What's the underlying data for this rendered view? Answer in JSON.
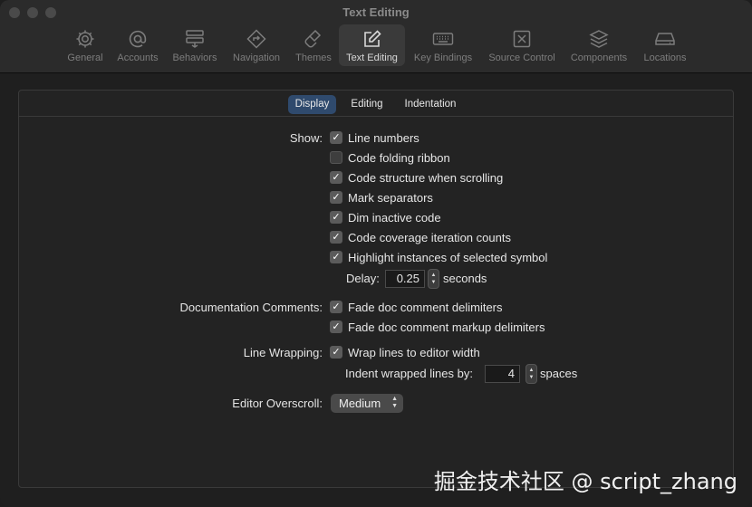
{
  "window": {
    "title": "Text Editing"
  },
  "toolbar": {
    "items": [
      {
        "label": "General",
        "icon": "gear-icon"
      },
      {
        "label": "Accounts",
        "icon": "at-icon"
      },
      {
        "label": "Behaviors",
        "icon": "behaviors-icon"
      },
      {
        "label": "Navigation",
        "icon": "navigation-icon"
      },
      {
        "label": "Themes",
        "icon": "brush-icon"
      },
      {
        "label": "Text Editing",
        "icon": "pencil-square-icon",
        "selected": true
      },
      {
        "label": "Key Bindings",
        "icon": "keyboard-icon"
      },
      {
        "label": "Source Control",
        "icon": "source-control-icon"
      },
      {
        "label": "Components",
        "icon": "layers-icon"
      },
      {
        "label": "Locations",
        "icon": "drive-icon"
      }
    ]
  },
  "tabs": [
    {
      "label": "Display",
      "active": true
    },
    {
      "label": "Editing",
      "active": false
    },
    {
      "label": "Indentation",
      "active": false
    }
  ],
  "show": {
    "label": "Show:",
    "options": [
      {
        "label": "Line numbers",
        "checked": true
      },
      {
        "label": "Code folding ribbon",
        "checked": false
      },
      {
        "label": "Code structure when scrolling",
        "checked": true
      },
      {
        "label": "Mark separators",
        "checked": true
      },
      {
        "label": "Dim inactive code",
        "checked": true
      },
      {
        "label": "Code coverage iteration counts",
        "checked": true
      },
      {
        "label": "Highlight instances of selected symbol",
        "checked": true
      }
    ],
    "delay_label": "Delay:",
    "delay_value": "0.25",
    "delay_unit": "seconds"
  },
  "doc_comments": {
    "label": "Documentation Comments:",
    "options": [
      {
        "label": "Fade doc comment delimiters",
        "checked": true
      },
      {
        "label": "Fade doc comment markup delimiters",
        "checked": true
      }
    ]
  },
  "line_wrapping": {
    "label": "Line Wrapping:",
    "option": {
      "label": "Wrap lines to editor width",
      "checked": true
    },
    "indent_label": "Indent wrapped lines by:",
    "indent_value": "4",
    "indent_unit": "spaces"
  },
  "overscroll": {
    "label": "Editor Overscroll:",
    "value": "Medium"
  },
  "check_glyph": "✓",
  "watermark": "掘金技术社区 @ script_zhang"
}
